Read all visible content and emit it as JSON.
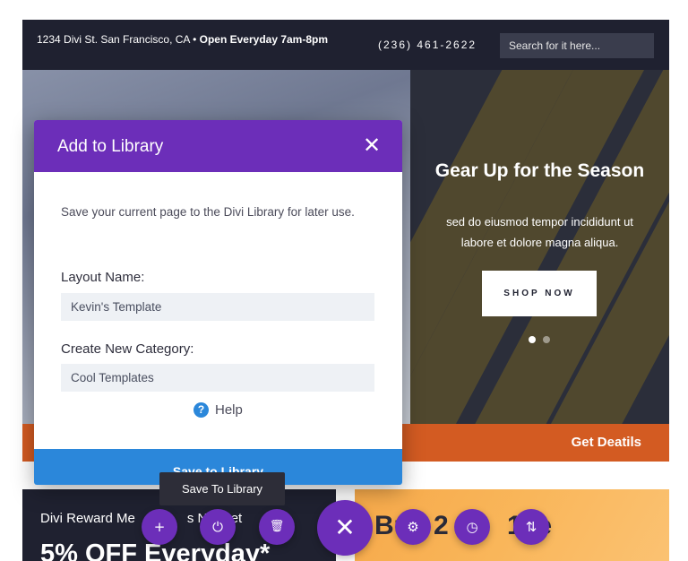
{
  "topbar": {
    "address": "1234 Divi St. San Francisco, CA •",
    "hours": "Open Everyday 7am-8pm",
    "phone": "(236) 461-2622",
    "search_placeholder": "Search for it here..."
  },
  "hero": {
    "title": "Gear Up for the Season",
    "subtitle": "sed do eiusmod tempor incididunt ut labore et dolore magna aliqua.",
    "button_label": "SHOP NOW"
  },
  "orange_bar": {
    "cta": "Get Deatils"
  },
  "lower": {
    "reward_text": "Divi Reward Me",
    "reward_text_tail": "s No",
    "reward_text_end": "et",
    "discount": "5% OFF Everyday*",
    "promo_a": "Bu",
    "promo_b": "2",
    "promo_c": "G",
    "promo_d": "1",
    "promo_e": "ee"
  },
  "modal": {
    "title": "Add to Library",
    "close_glyph": "✕",
    "description": "Save your current page to the Divi Library for later use.",
    "layout_name_label": "Layout Name:",
    "layout_name_value": "Kevin's Template",
    "category_label": "Create New Category:",
    "category_value": "Cool Templates",
    "help_glyph": "?",
    "help_label": "Help",
    "save_label": "Save to Library"
  },
  "tooltip": {
    "text": "Save To Library"
  },
  "builder_bar": {
    "add_glyph": "+",
    "save_glyph": "⏻",
    "trash_glyph": "🗑",
    "close_glyph": "✕",
    "settings_glyph": "⚙",
    "history_glyph": "◷",
    "portability_glyph": "⇅"
  },
  "colors": {
    "purple": "#6c2eb9",
    "blue": "#2b87da",
    "orange": "#d35b22",
    "dark": "#1f2130"
  }
}
